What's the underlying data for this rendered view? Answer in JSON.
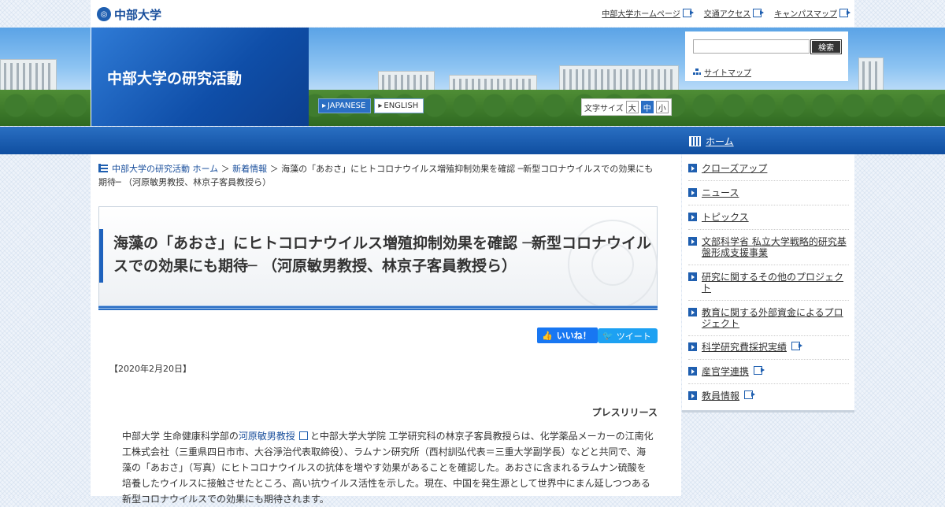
{
  "top": {
    "logo_text": "中部大学",
    "logo_mark": "◎",
    "links": [
      "中部大学ホームページ",
      "交通アクセス",
      "キャンパスマップ"
    ]
  },
  "header": {
    "site_title": "中部大学の研究活動",
    "lang_japanese": "JAPANESE",
    "lang_english": "ENGLISH",
    "font_size_label": "文字サイズ",
    "font_sizes": [
      "大",
      "中",
      "小"
    ],
    "search_placeholder": "",
    "search_button": "検索",
    "sitemap": "サイトマップ"
  },
  "nav": {
    "home": "ホーム"
  },
  "breadcrumb": {
    "home": "中部大学の研究活動 ホーム",
    "sep1": " ＞ ",
    "news": "新着情報",
    "sep2": " ＞ ",
    "current": "海藻の「あおさ」にヒトコロナウイルス増殖抑制効果を確認 ─新型コロナウイルスでの効果にも期待─ （河原敏男教授、林京子客員教授ら）"
  },
  "article": {
    "title": "海藻の「あおさ」にヒトコロナウイルス増殖抑制効果を確認 ─新型コロナウイルスでの効果にも期待─ （河原敏男教授、林京子客員教授ら）",
    "like": "いいね！",
    "tweet": "ツイート",
    "date": "【2020年2月20日】",
    "press_release": "プレスリリース",
    "body_prefix": "中部大学 生命健康科学部の",
    "body_link": "河原敏男教授",
    "body_rest": "と中部大学大学院 工学研究科の林京子客員教授らは、化学薬品メーカーの江南化工株式会社（三重県四日市市、大谷淨治代表取締役）、ラムナン研究所（西村訓弘代表＝三重大学副学長）などと共同で、海藻の「あおさ」（写真）にヒトコロナウイルスの抗体を増やす効果があることを確認した。あおさに含まれるラムナン硫酸を培養したウイルスに接触させたところ、高い抗ウイルス活性を示した。現在、中国を発生源として世界中にまん延しつつある新型コロナウイルスでの効果にも期待されます。"
  },
  "sidebar": {
    "items": [
      "クローズアップ",
      "ニュース",
      "トピックス",
      "文部科学省 私立大学戦略的研究基盤形成支援事業",
      "研究に関するその他のプロジェクト",
      "教育に関する外部資金によるプロジェクト",
      "科学研究費採択実績",
      "産官学連携",
      "教員情報"
    ]
  },
  "colors": {
    "brand_blue": "#1f5fb0",
    "nav_blue": "#1a5fb4",
    "link": "#1a4f9c"
  }
}
